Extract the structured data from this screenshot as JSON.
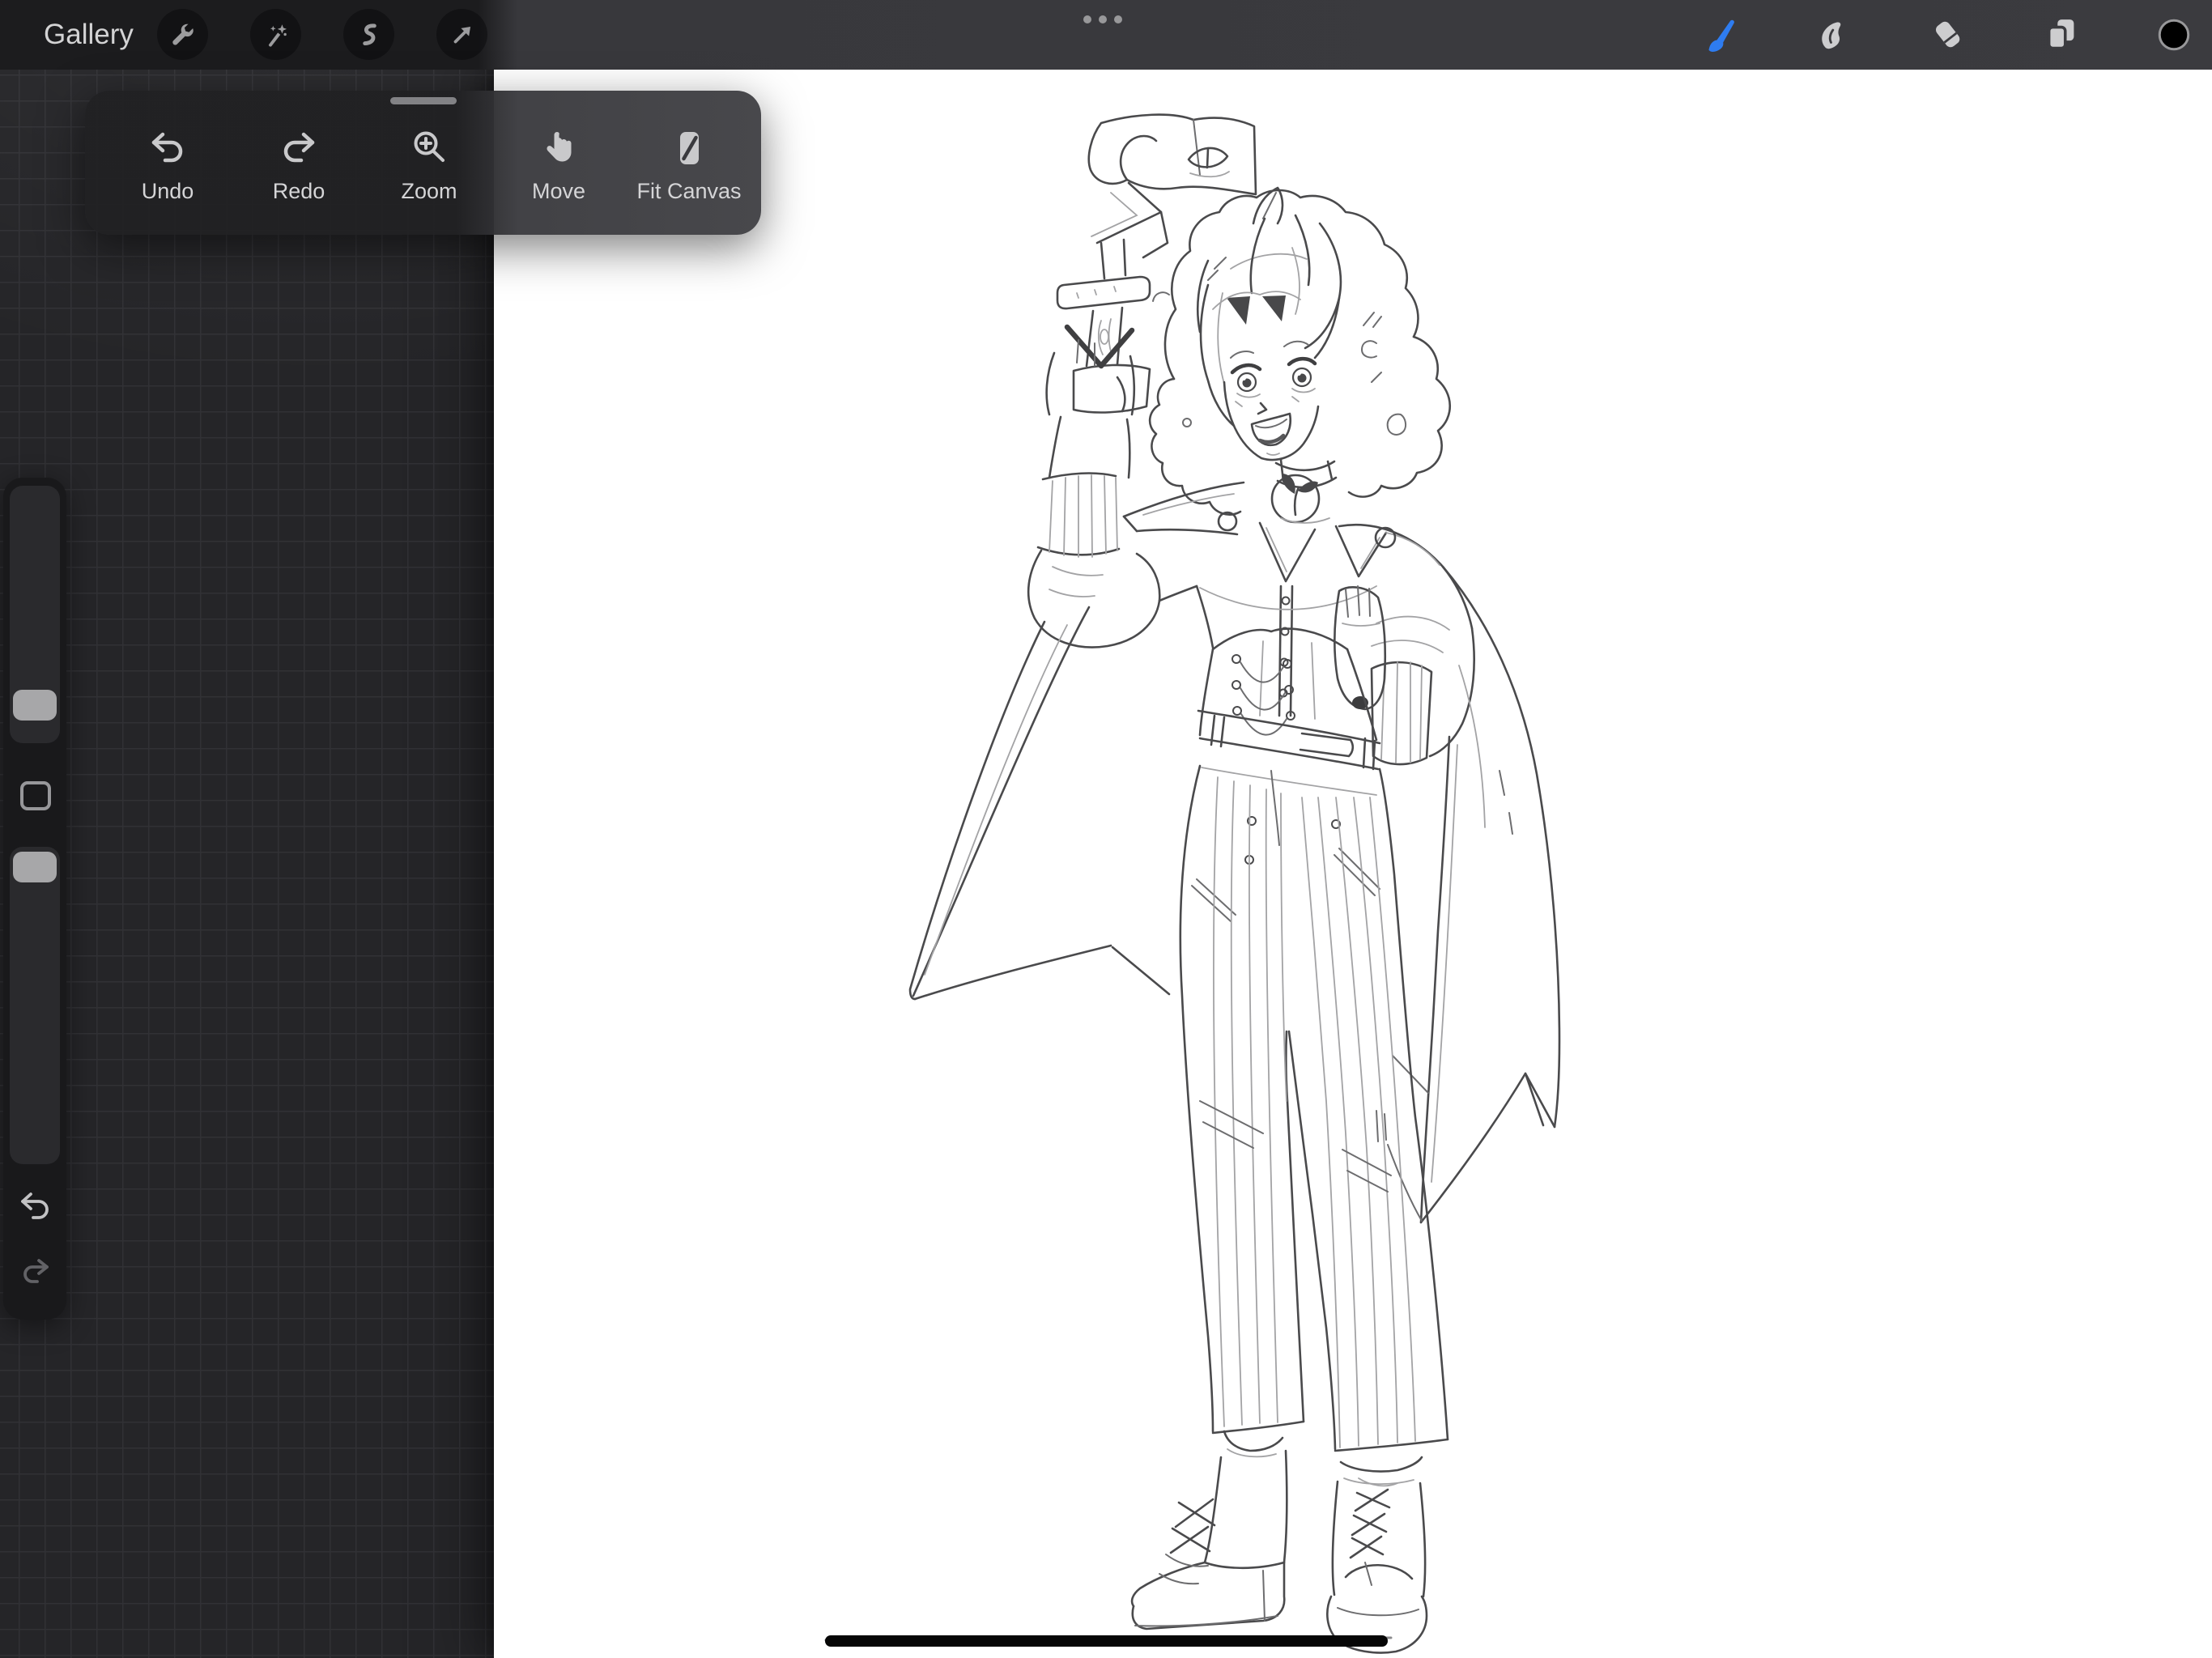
{
  "topbar": {
    "gallery_label": "Gallery",
    "left_tools": [
      {
        "id": "actions",
        "icon": "wrench-icon"
      },
      {
        "id": "adjustments",
        "icon": "magic-wand-icon"
      },
      {
        "id": "selection",
        "icon": "selection-s-icon"
      },
      {
        "id": "transform",
        "icon": "transform-arrow-icon"
      }
    ],
    "multitask_indicator": "ellipsis-icon",
    "right_tools": [
      {
        "id": "paint",
        "icon": "brush-icon",
        "active": true
      },
      {
        "id": "smudge",
        "icon": "smudge-icon",
        "active": false
      },
      {
        "id": "erase",
        "icon": "eraser-icon",
        "active": false
      },
      {
        "id": "layers",
        "icon": "layers-icon",
        "active": false
      },
      {
        "id": "color",
        "icon": "color-swatch-icon",
        "value": "#000000"
      }
    ],
    "accent_color": "#2e7cf0"
  },
  "quick_toolbar": {
    "items": [
      {
        "label": "Undo",
        "icon": "undo-arrow-icon"
      },
      {
        "label": "Redo",
        "icon": "redo-arrow-icon"
      },
      {
        "label": "Zoom",
        "icon": "zoom-magnifier-icon"
      },
      {
        "label": "Move",
        "icon": "move-hand-icon"
      },
      {
        "label": "Fit Canvas",
        "icon": "fit-canvas-icon"
      }
    ]
  },
  "sidebar": {
    "controls": [
      "brush-size-slider",
      "modify-button",
      "opacity-slider",
      "undo-arrow",
      "redo-arrow"
    ]
  },
  "canvas": {
    "background": "#ffffff",
    "artwork": {
      "type": "pencil-line-sketch",
      "subject": "standing girl with curly bob hair, smiling, raising a wooden staff topped by an eye banner, wearing caped jacket, corset with chain, high-waisted striped wide-leg trousers and lace-up platform boots",
      "ink_color": "#4a4a4c"
    }
  },
  "home_indicator": {
    "color": "#060606"
  }
}
